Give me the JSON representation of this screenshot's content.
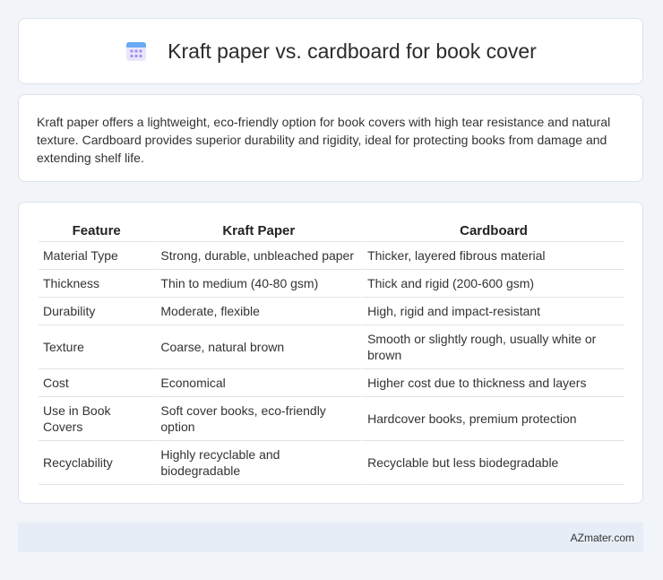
{
  "header": {
    "title": "Kraft paper vs. cardboard for book cover",
    "icon": "calendar-icon"
  },
  "summary": {
    "text": "Kraft paper offers a lightweight, eco-friendly option for book covers with high tear resistance and natural texture. Cardboard provides superior durability and rigidity, ideal for protecting books from damage and extending shelf life."
  },
  "table": {
    "headers": [
      "Feature",
      "Kraft Paper",
      "Cardboard"
    ],
    "rows": [
      [
        "Material Type",
        "Strong, durable, unbleached paper",
        "Thicker, layered fibrous material"
      ],
      [
        "Thickness",
        "Thin to medium (40-80 gsm)",
        "Thick and rigid (200-600 gsm)"
      ],
      [
        "Durability",
        "Moderate, flexible",
        "High, rigid and impact-resistant"
      ],
      [
        "Texture",
        "Coarse, natural brown",
        "Smooth or slightly rough, usually white or brown"
      ],
      [
        "Cost",
        "Economical",
        "Higher cost due to thickness and layers"
      ],
      [
        "Use in Book Covers",
        "Soft cover books, eco-friendly option",
        "Hardcover books, premium protection"
      ],
      [
        "Recyclability",
        "Highly recyclable and biodegradable",
        "Recyclable but less biodegradable"
      ]
    ]
  },
  "footer": {
    "brand": "AZmater.com"
  }
}
